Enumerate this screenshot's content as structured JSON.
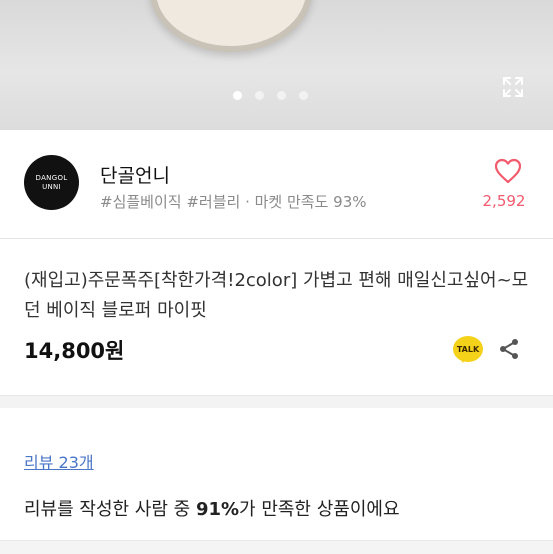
{
  "gallery": {
    "dots": [
      true,
      false,
      false,
      false
    ],
    "fullscreen_icon": "expand-icon"
  },
  "shop": {
    "logo_line1": "DANGOL",
    "logo_line2": "UNNI",
    "name": "단골언니",
    "tags": "#심플베이직 #러블리 · 마켓 만족도 93%",
    "likes": "2,592",
    "like_color": "#f25a6e"
  },
  "product": {
    "title": "(재입고)주문폭주[착한가격!2color] 가볍고 편해 매일신고싶어~모던 베이직 블로퍼 마이핏",
    "price": "14,800원",
    "talk_label": "TALK",
    "share_icon": "share-icon"
  },
  "review": {
    "link_label": "리뷰 23개",
    "summary_prefix": "리뷰를 작성한 사람 중 ",
    "summary_percent": "91%",
    "summary_suffix": "가 만족한 상품이에요",
    "link_color": "#4a76c8"
  }
}
